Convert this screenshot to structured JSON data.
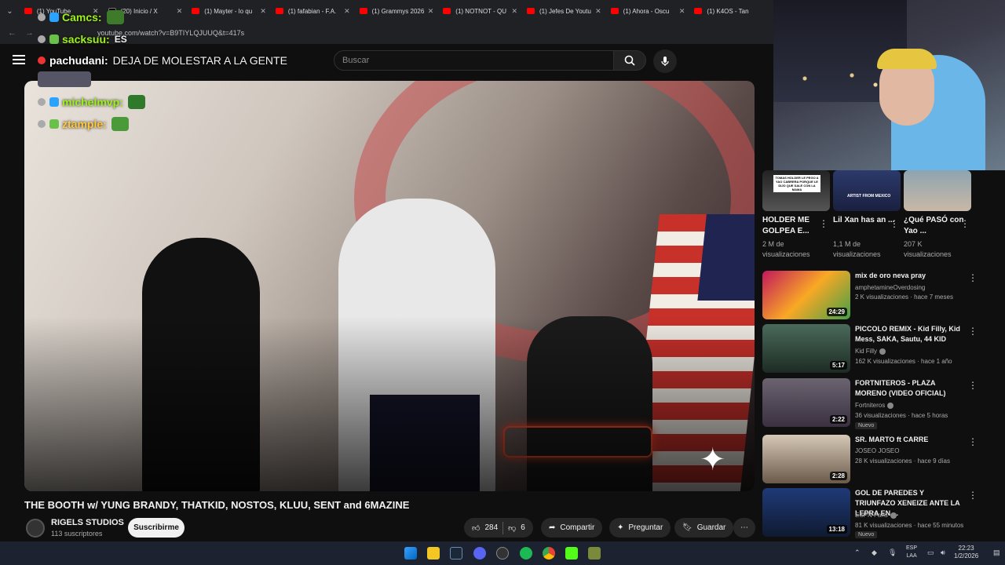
{
  "browser": {
    "tabs": [
      {
        "label": "(1) YouTube",
        "type": "yt"
      },
      {
        "label": "(20) Inicio / X",
        "type": "x"
      },
      {
        "label": "(1) Mayter - lo qu",
        "type": "yt"
      },
      {
        "label": "(1) fafabian - F.A.",
        "type": "yt"
      },
      {
        "label": "(1) Grammys 2026",
        "type": "yt"
      },
      {
        "label": "(1) NOTNOT - QU",
        "type": "yt"
      },
      {
        "label": "(1) Jefes De Youtu",
        "type": "yt"
      },
      {
        "label": "(1) Ahora - Oscu",
        "type": "yt"
      },
      {
        "label": "(1) K4OS - Tan",
        "type": "yt"
      }
    ],
    "url": "youtube.com/watch?v=B9TIYLQJUUQ&t=417s"
  },
  "youtube": {
    "search_placeholder": "Buscar",
    "video_title": "THE BOOTH w/ YUNG BRANDY, THATKID, NOSTOS, KLUU, SENT and 6MAZINE",
    "channel_name": "RIGELS STUDIOS",
    "subscribers": "113 suscriptores",
    "subscribe_label": "Suscribirme",
    "likes": "284",
    "dislikes": "6",
    "share_label": "Compartir",
    "ask_label": "Preguntar",
    "save_label": "Guardar",
    "more_label": "⋯"
  },
  "chat": [
    {
      "user": "Camcs:",
      "message": "",
      "color": "#9ef01a"
    },
    {
      "user": "sacksuu:",
      "message": "ES",
      "color": "#9ef01a"
    },
    {
      "user": "pachudani:",
      "message": "DEJA DE MOLESTAR A LA GENTE",
      "color": "#ffffff"
    },
    {
      "user": "michelmvp:",
      "message": "",
      "color": "#9ef01a"
    },
    {
      "user": "ztample:",
      "message": "",
      "color": "#ffc83d"
    }
  ],
  "shorts": [
    {
      "title": "HOLDER ME GOLPEA E...",
      "views": "2 M de visualizaciones",
      "caption": "TOMAS HOLDER LE PEGO A YAO CABRERA PORQUE LE DIJO QUE SALE CON LA MAMA"
    },
    {
      "title": "Lil Xan has an ...",
      "views": "1,1 M de visualizaciones",
      "caption": "ARTIST FROM MEXICO"
    },
    {
      "title": "¿Qué PASÓ con Yao ...",
      "views": "207 K visualizaciones",
      "caption": ""
    }
  ],
  "recommendations": [
    {
      "title": "mix de oro neva pray",
      "channel": "amphetamineOverdosing",
      "verified": false,
      "meta": "2 K visualizaciones · hace 7 meses",
      "duration": "24:29",
      "badge": ""
    },
    {
      "title": "PICCOLO REMIX - Kid Filly,  Kid Mess, SAKA, Sautu, 44 KID",
      "channel": "Kid Filly",
      "verified": true,
      "meta": "162 K visualizaciones · hace 1 año",
      "duration": "5:17",
      "badge": ""
    },
    {
      "title": "FORTNITEROS - PLAZA MORENO (VIDEO OFICIAL)",
      "channel": "Fortniteros",
      "verified": true,
      "meta": "36 visualizaciones · hace 5 horas",
      "duration": "2:22",
      "badge": "Nuevo"
    },
    {
      "title": "SR. MARTO ft CARRE",
      "channel": "JOSEO JOSEO",
      "verified": false,
      "meta": "28 K visualizaciones · hace 9 días",
      "duration": "2:28",
      "badge": ""
    },
    {
      "title": "GOL DE PAREDES Y TRIUNFAZO XENEIZE ANTE LA LEPRA EN ...",
      "channel": "ESPN Fans",
      "verified": true,
      "meta": "81 K visualizaciones · hace 55 minutos",
      "duration": "13:18",
      "badge": "Nuevo"
    }
  ],
  "taskbar": {
    "lang": "ESP",
    "lang2": "LAA",
    "time": "22:23",
    "date": "1/2/2026"
  }
}
